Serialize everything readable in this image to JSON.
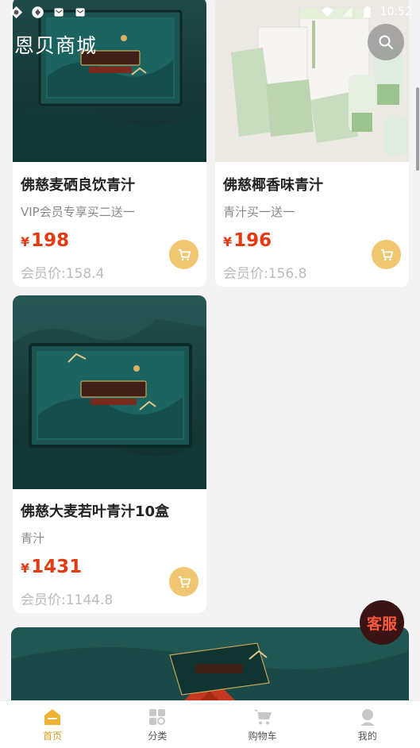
{
  "status_bar": {
    "time": "10:52"
  },
  "header": {
    "title": "恩贝商城"
  },
  "products": [
    {
      "name": "佛慈麦硒良饮青汁",
      "subtitle": "VIP会员专享买二送一",
      "currency": "¥",
      "price": "198",
      "member_price": "会员价:158.4",
      "image": "green-tea-giftbox"
    },
    {
      "name": "佛慈椰香味青汁",
      "subtitle": "青汁买一送一",
      "currency": "¥",
      "price": "196",
      "member_price": "会员价:156.8",
      "image": "coconut-qingzhi-pouches"
    },
    {
      "name": "佛慈大麦若叶青汁10盒",
      "subtitle": "青汁",
      "currency": "¥",
      "price": "1431",
      "member_price": "会员价:1144.8",
      "image": "green-tea-giftbox"
    }
  ],
  "service": {
    "label": "客服"
  },
  "nav": [
    {
      "label": "首页",
      "icon": "home-icon",
      "active": true
    },
    {
      "label": "分类",
      "icon": "category-icon",
      "active": false
    },
    {
      "label": "购物车",
      "icon": "cart-icon",
      "active": false
    },
    {
      "label": "我的",
      "icon": "user-icon",
      "active": false
    }
  ],
  "colors": {
    "price": "#e33a12",
    "accent": "#d99a1e",
    "cart_button": "#f0c770"
  }
}
